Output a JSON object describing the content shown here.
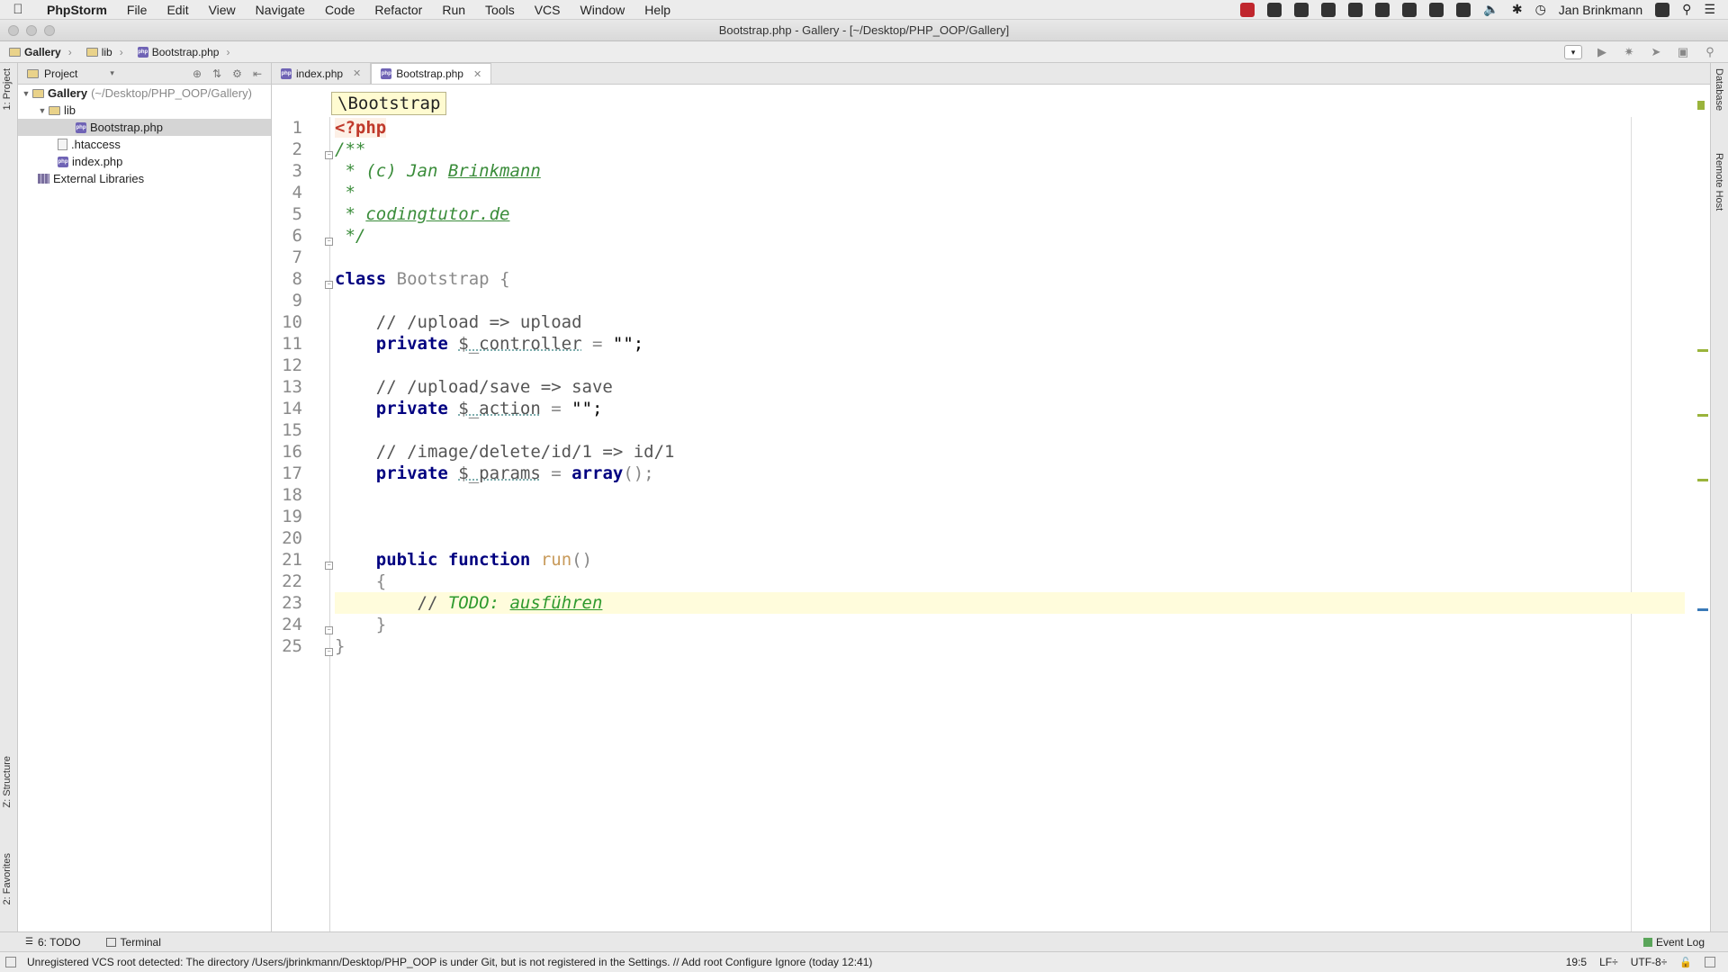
{
  "menubar": {
    "app_name": "PhpStorm",
    "items": [
      "File",
      "Edit",
      "View",
      "Navigate",
      "Code",
      "Refactor",
      "Run",
      "Tools",
      "VCS",
      "Window",
      "Help"
    ],
    "user": "Jan Brinkmann"
  },
  "window": {
    "title": "Bootstrap.php - Gallery - [~/Desktop/PHP_OOP/Gallery]"
  },
  "navbar": {
    "crumbs": [
      "Gallery",
      "lib",
      "Bootstrap.php"
    ]
  },
  "left_strip": {
    "project_tab": "1: Project",
    "structure_tab": "Z: Structure",
    "favorites_tab": "2: Favorites"
  },
  "right_strip": {
    "database_tab": "Database",
    "remote_host_tab": "Remote Host"
  },
  "project_panel": {
    "header": "Project",
    "tree": {
      "root_name": "Gallery",
      "root_path": "(~/Desktop/PHP_OOP/Gallery)",
      "lib": "lib",
      "bootstrap": "Bootstrap.php",
      "htaccess": ".htaccess",
      "index": "index.php",
      "external": "External Libraries"
    }
  },
  "tabs": {
    "tab1": "index.php",
    "tab2": "Bootstrap.php"
  },
  "editor": {
    "hint": "\\Bootstrap",
    "line_numbers": [
      "1",
      "2",
      "3",
      "4",
      "5",
      "6",
      "7",
      "8",
      "9",
      "10",
      "11",
      "12",
      "13",
      "14",
      "15",
      "16",
      "17",
      "18",
      "19",
      "20",
      "21",
      "22",
      "23",
      "24",
      "25"
    ],
    "code": {
      "l1": "<?php",
      "l2": "/**",
      "l3_prefix": " * (c) Jan ",
      "l3_name": "Brinkmann",
      "l4": " *",
      "l5_prefix": " * ",
      "l5_link": "codingtutor.de",
      "l6": " */",
      "l8_kw": "class",
      "l8_name": "Bootstrap",
      "l8_brace": "{",
      "l10": "    // /upload => upload",
      "l11_kw": "private",
      "l11_var": "$_controller",
      "l11_eq": " = ",
      "l11_val": "\"\";",
      "l13": "    // /upload/save => save",
      "l14_kw": "private",
      "l14_var": "$_action",
      "l14_eq": " = ",
      "l14_val": "\"\";",
      "l16": "    // /image/delete/id/1 => id/1",
      "l17_kw": "private",
      "l17_var": "$_params",
      "l17_eq": " = ",
      "l17_fn": "array",
      "l17_end": "();",
      "l21_kw1": "public",
      "l21_kw2": "function",
      "l21_name": "run",
      "l21_paren": "()",
      "l22": "    {",
      "l23_prefix": "        // ",
      "l23_todo": "TODO: ",
      "l23_word": "ausführen",
      "l24": "    }",
      "l25": "}"
    }
  },
  "bottom_bar": {
    "todo": "6: TODO",
    "terminal": "Terminal",
    "event_log": "Event Log"
  },
  "status_bar": {
    "message": "Unregistered VCS root detected: The directory /Users/jbrinkmann/Desktop/PHP_OOP is under Git, but is not registered in the Settings. // Add root  Configure  Ignore (today 12:41)",
    "position": "19:5",
    "line_sep": "LF÷",
    "encoding": "UTF-8÷"
  }
}
